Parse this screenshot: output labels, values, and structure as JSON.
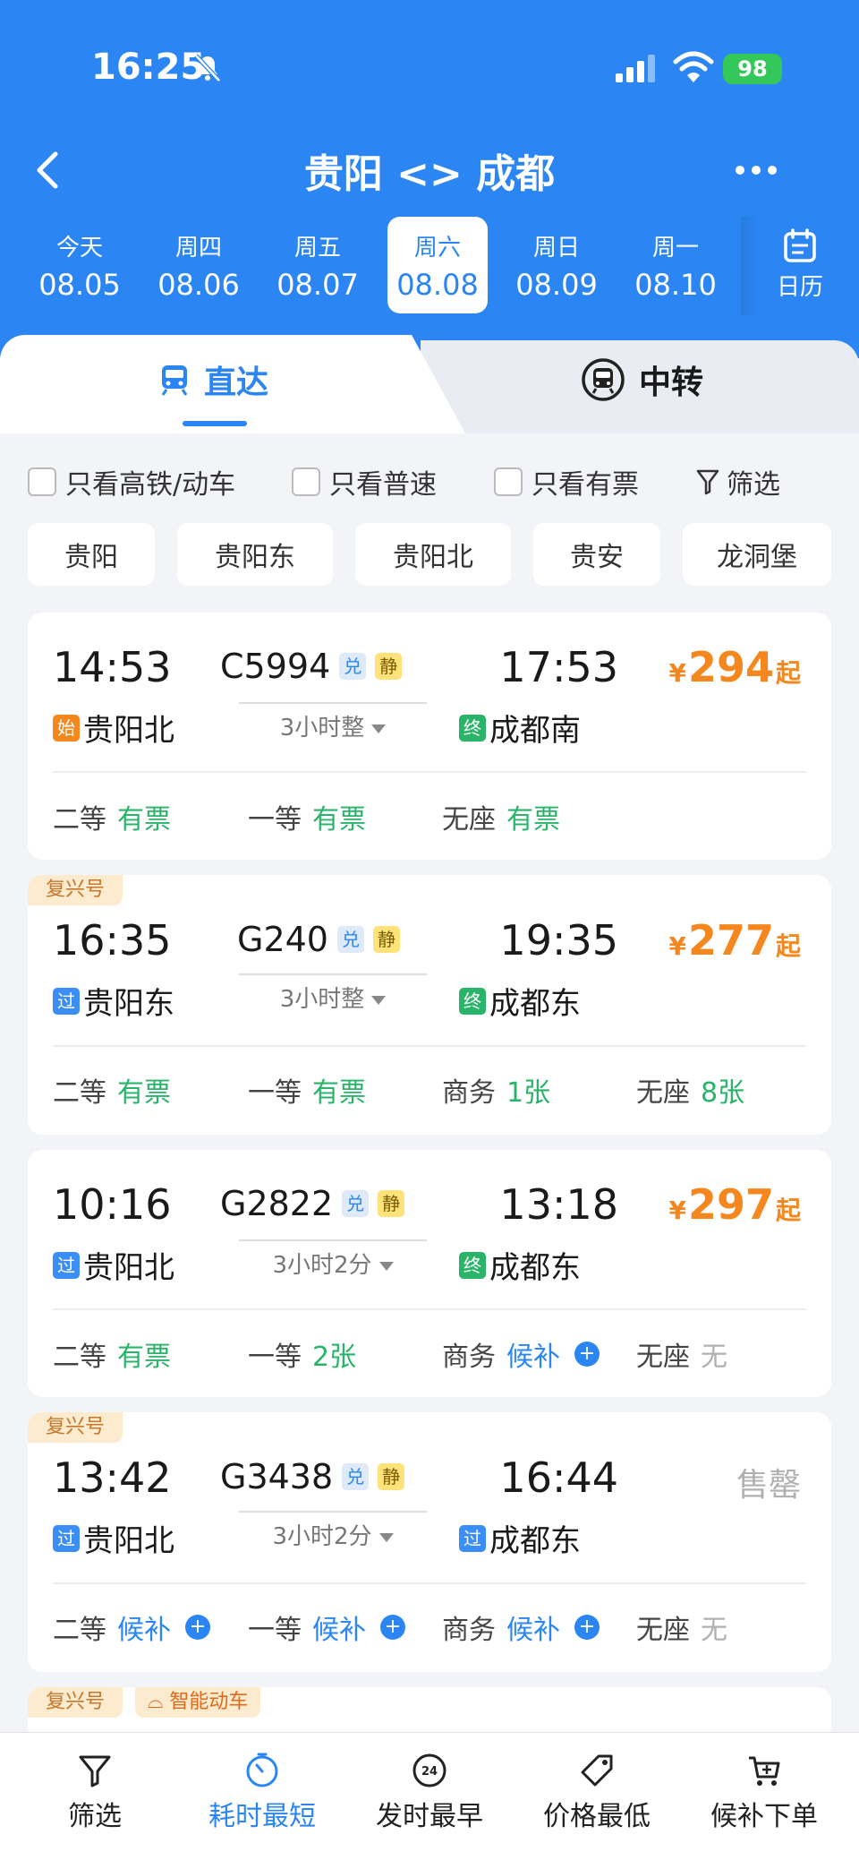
{
  "status_bar": {
    "time": "16:25",
    "battery": "98"
  },
  "nav": {
    "title": "贵阳 <> 成都"
  },
  "dates": [
    {
      "weekday": "今天",
      "date": "08.05"
    },
    {
      "weekday": "周四",
      "date": "08.06"
    },
    {
      "weekday": "周五",
      "date": "08.07"
    },
    {
      "weekday": "周六",
      "date": "08.08",
      "selected": true
    },
    {
      "weekday": "周日",
      "date": "08.09"
    },
    {
      "weekday": "周一",
      "date": "08.10"
    }
  ],
  "calendar_label": "日历",
  "tabs": {
    "direct": "直达",
    "transfer": "中转"
  },
  "filters": {
    "gaotie": "只看高铁/动车",
    "pusu": "只看普速",
    "youpiao": "只看有票",
    "shaixuan": "筛选"
  },
  "stations": [
    "贵阳",
    "贵阳东",
    "贵阳北",
    "贵安",
    "龙洞堡"
  ],
  "trains": [
    {
      "dep_time": "14:53",
      "number": "C5994",
      "arr_time": "17:53",
      "duration": "3小时整",
      "from_tag": "始",
      "from": "贵阳北",
      "to_tag": "终",
      "to": "成都南",
      "price": "294",
      "price_unit": "¥",
      "price_suffix": "起",
      "seats": [
        {
          "class": "二等",
          "status": "有票"
        },
        {
          "class": "一等",
          "status": "有票"
        },
        {
          "class": "无座",
          "status": "有票"
        }
      ]
    },
    {
      "badge": "复兴号",
      "dep_time": "16:35",
      "number": "G240",
      "arr_time": "19:35",
      "duration": "3小时整",
      "from_tag": "过",
      "from": "贵阳东",
      "to_tag": "终",
      "to": "成都东",
      "price": "277",
      "price_unit": "¥",
      "price_suffix": "起",
      "seats": [
        {
          "class": "二等",
          "status": "有票"
        },
        {
          "class": "一等",
          "status": "有票"
        },
        {
          "class": "商务",
          "status": "1张"
        },
        {
          "class": "无座",
          "status": "8张"
        }
      ]
    },
    {
      "dep_time": "10:16",
      "number": "G2822",
      "arr_time": "13:18",
      "duration": "3小时2分",
      "from_tag": "过",
      "from": "贵阳北",
      "to_tag": "终",
      "to": "成都东",
      "price": "297",
      "price_unit": "¥",
      "price_suffix": "起",
      "seats": [
        {
          "class": "二等",
          "status": "有票"
        },
        {
          "class": "一等",
          "status": "2张"
        },
        {
          "class": "商务",
          "status": "候补"
        },
        {
          "class": "无座",
          "status": "无"
        }
      ]
    },
    {
      "badge": "复兴号",
      "dep_time": "13:42",
      "number": "G3438",
      "arr_time": "16:44",
      "duration": "3小时2分",
      "from_tag": "过",
      "from": "贵阳北",
      "to_tag": "过",
      "to": "成都东",
      "sold_out": "售罄",
      "seats": [
        {
          "class": "二等",
          "status": "候补"
        },
        {
          "class": "一等",
          "status": "候补"
        },
        {
          "class": "商务",
          "status": "候补"
        },
        {
          "class": "无座",
          "status": "无"
        }
      ]
    }
  ],
  "partial_card": {
    "badge": "复兴号",
    "badge2": "智能动车"
  },
  "tag_labels": {
    "dui": "兑",
    "jing": "静"
  },
  "bottom_bar": [
    "筛选",
    "耗时最短",
    "发时最早",
    "价格最低",
    "候补下单"
  ],
  "colors": {
    "brand": "#2b86f3",
    "price": "#f5871f",
    "available": "#29b46a"
  }
}
